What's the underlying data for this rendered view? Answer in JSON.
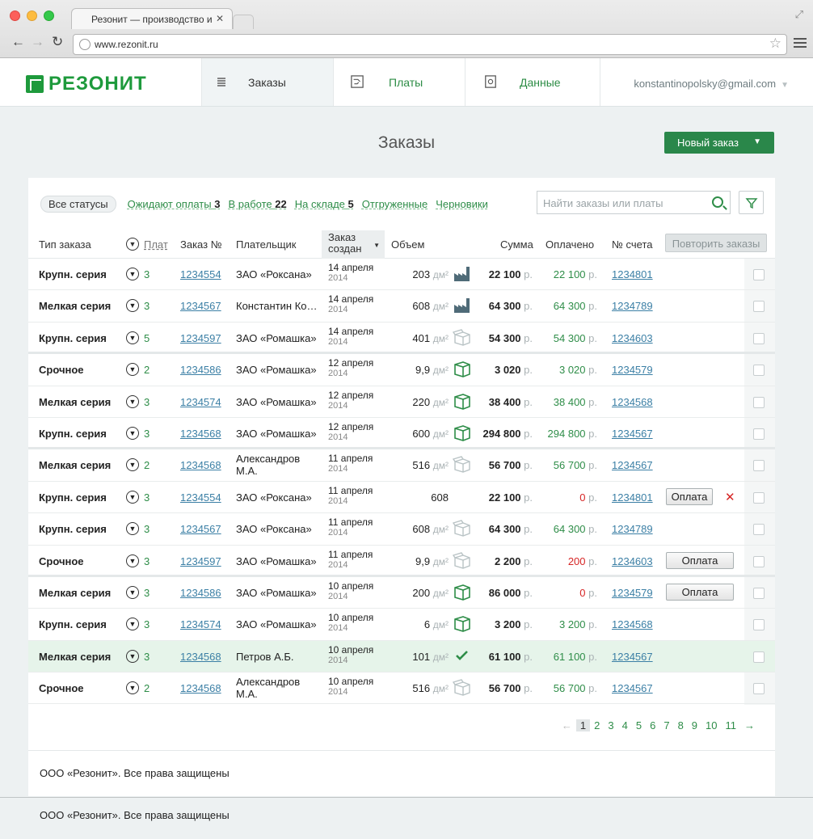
{
  "browser": {
    "tab_title": "Резонит — производство и",
    "url": "www.rezonit.ru"
  },
  "header": {
    "logo": "РЕЗОНИТ",
    "tabs": [
      "Заказы",
      "Платы",
      "Данные"
    ],
    "user": "konstantinopolsky@gmail.com"
  },
  "page": {
    "title": "Заказы",
    "new_order": "Новый заказ"
  },
  "filters": {
    "all": "Все статусы",
    "awaiting": "Ожидают оплаты",
    "awaiting_count": "3",
    "in_work": "В работе",
    "in_work_count": "22",
    "in_stock": "На складе",
    "in_stock_count": "5",
    "shipped": "Отгруженные",
    "drafts": "Черновики",
    "search_placeholder": "Найти заказы или платы"
  },
  "columns": {
    "type": "Тип заказа",
    "boards": "Плат",
    "number": "Заказ №",
    "payer": "Плательщик",
    "created_1": "Заказ",
    "created_2": "создан",
    "volume": "Объем",
    "sum": "Сумма",
    "paid": "Оплачено",
    "invoice": "№ счета",
    "repeat": "Повторить заказы"
  },
  "colors": {
    "brand": "#1e9a3c",
    "link": "#3b7fa5",
    "paid": "#2e8d48",
    "unpaid": "#d62525"
  },
  "rows": [
    {
      "type": "Крупн. серия",
      "count": "3",
      "num": "1234554",
      "payer": "ЗАО «Роксана»",
      "day": "14 апреля",
      "year": "2014",
      "vol": "203",
      "unit": "дм²",
      "icon": "factory-icon",
      "sum": "22 100",
      "cur": "р.",
      "paid": "22 100",
      "pcur": "р.",
      "inv": "1234801"
    },
    {
      "type": "Мелкая серия",
      "count": "3",
      "num": "1234567",
      "payer": "Константин Ко…",
      "day": "14 апреля",
      "year": "2014",
      "vol": "608",
      "unit": "дм²",
      "icon": "factory-icon",
      "sum": "64 300",
      "cur": "р.",
      "paid": "64 300",
      "pcur": "р.",
      "inv": "1234789"
    },
    {
      "type": "Крупн. серия",
      "count": "5",
      "num": "1234597",
      "payer": "ЗАО «Ромашка»",
      "day": "14 апреля",
      "year": "2014",
      "vol": "401",
      "unit": "дм²",
      "icon": "box-open-icon",
      "sum": "54 300",
      "cur": "р.",
      "paid": "54 300",
      "pcur": "р.",
      "inv": "1234603"
    },
    {
      "type": "Срочное",
      "count": "2",
      "num": "1234586",
      "payer": "ЗАО «Ромашка»",
      "day": "12 апреля",
      "year": "2014",
      "vol": "9,9",
      "unit": "дм²",
      "icon": "box-icon",
      "sum": "3 020",
      "cur": "р.",
      "paid": "3 020",
      "pcur": "р.",
      "inv": "1234579"
    },
    {
      "type": "Мелкая серия",
      "count": "3",
      "num": "1234574",
      "payer": "ЗАО «Ромашка»",
      "day": "12 апреля",
      "year": "2014",
      "vol": "220",
      "unit": "дм²",
      "icon": "box-icon",
      "sum": "38 400",
      "cur": "р.",
      "paid": "38 400",
      "pcur": "р.",
      "inv": "1234568"
    },
    {
      "type": "Крупн. серия",
      "count": "3",
      "num": "1234568",
      "payer": "ЗАО «Ромашка»",
      "day": "12 апреля",
      "year": "2014",
      "vol": "600",
      "unit": "дм²",
      "icon": "box-icon",
      "sum": "294 800",
      "cur": "р.",
      "paid": "294 800",
      "pcur": "р.",
      "inv": "1234567"
    },
    {
      "type": "Мелкая серия",
      "count": "2",
      "num": "1234568",
      "payer": "Александров М.А.",
      "day": "11 апреля",
      "year": "2014",
      "vol": "516",
      "unit": "дм²",
      "icon": "box-open-icon",
      "sum": "56 700",
      "cur": "р.",
      "paid": "56 700",
      "pcur": "р.",
      "inv": "1234567"
    },
    {
      "type": "Крупн. серия",
      "count": "3",
      "num": "1234554",
      "payer": "ЗАО «Роксана»",
      "day": "11 апреля",
      "year": "2014",
      "vol": "608",
      "unit": "",
      "icon": "",
      "sum": "22 100",
      "cur": "р.",
      "paid": "0",
      "pcur": "р.",
      "inv": "1234801",
      "pay": "Оплата",
      "cancel": true
    },
    {
      "type": "Крупн. серия",
      "count": "3",
      "num": "1234567",
      "payer": "ЗАО «Роксана»",
      "day": "11 апреля",
      "year": "2014",
      "vol": "608",
      "unit": "дм²",
      "icon": "box-open-icon",
      "sum": "64 300",
      "cur": "р.",
      "paid": "64 300",
      "pcur": "р.",
      "inv": "1234789"
    },
    {
      "type": "Срочное",
      "count": "3",
      "num": "1234597",
      "payer": "ЗАО «Ромашка»",
      "day": "11 апреля",
      "year": "2014",
      "vol": "9,9",
      "unit": "дм²",
      "icon": "box-open-icon",
      "sum": "2 200",
      "cur": "р.",
      "paid": "200",
      "pcur": "р.",
      "inv": "1234603",
      "pay": "Оплата"
    },
    {
      "type": "Мелкая серия",
      "count": "3",
      "num": "1234586",
      "payer": "ЗАО «Ромашка»",
      "day": "10 апреля",
      "year": "2014",
      "vol": "200",
      "unit": "дм²",
      "icon": "box-icon",
      "sum": "86 000",
      "cur": "р.",
      "paid": "0",
      "pcur": "р.",
      "inv": "1234579",
      "pay": "Оплата"
    },
    {
      "type": "Крупн. серия",
      "count": "3",
      "num": "1234574",
      "payer": "ЗАО «Ромашка»",
      "day": "10 апреля",
      "year": "2014",
      "vol": "6",
      "unit": "дм²",
      "icon": "box-icon",
      "sum": "3 200",
      "cur": "р.",
      "paid": "3 200",
      "pcur": "р.",
      "inv": "1234568"
    },
    {
      "type": "Мелкая серия",
      "count": "3",
      "num": "1234568",
      "payer": "Петров А.Б.",
      "day": "10 апреля",
      "year": "2014",
      "vol": "101",
      "unit": "дм²",
      "icon": "check-icon",
      "sum": "61 100",
      "cur": "р.",
      "paid": "61 100",
      "pcur": "р.",
      "inv": "1234567",
      "hl": true
    },
    {
      "type": "Срочное",
      "count": "2",
      "num": "1234568",
      "payer": "Александров М.А.",
      "day": "10 апреля",
      "year": "2014",
      "vol": "516",
      "unit": "дм²",
      "icon": "box-open-icon",
      "sum": "56 700",
      "cur": "р.",
      "paid": "56 700",
      "pcur": "р.",
      "inv": "1234567"
    }
  ],
  "pager": {
    "prev": "←",
    "pages": [
      "1",
      "2",
      "3",
      "4",
      "5",
      "6",
      "7",
      "8",
      "9",
      "10",
      "11"
    ],
    "next": "→",
    "current": "1"
  },
  "footer": {
    "inner": "ООО «Резонит». Все права защищены",
    "outer": "ООО «Резонит». Все права защищены"
  }
}
